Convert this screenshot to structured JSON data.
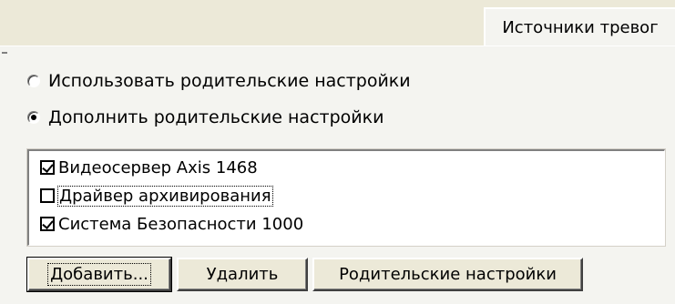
{
  "tabs": [
    {
      "label": "Источники тревог",
      "active": true
    }
  ],
  "mode_radios": [
    {
      "label": "Использовать родительские настройки",
      "checked": false
    },
    {
      "label": "Дополнить родительские настройки",
      "checked": true
    }
  ],
  "sources_list": [
    {
      "label": "Видеосервер Axis 1468",
      "checked": true
    },
    {
      "label": "Драйвер архивирования",
      "checked": false,
      "focused": true
    },
    {
      "label": "Система Безопасности 1000",
      "checked": true
    }
  ],
  "buttons": {
    "add": "Добавить...",
    "delete": "Удалить",
    "parent_settings": "Родительские настройки"
  }
}
